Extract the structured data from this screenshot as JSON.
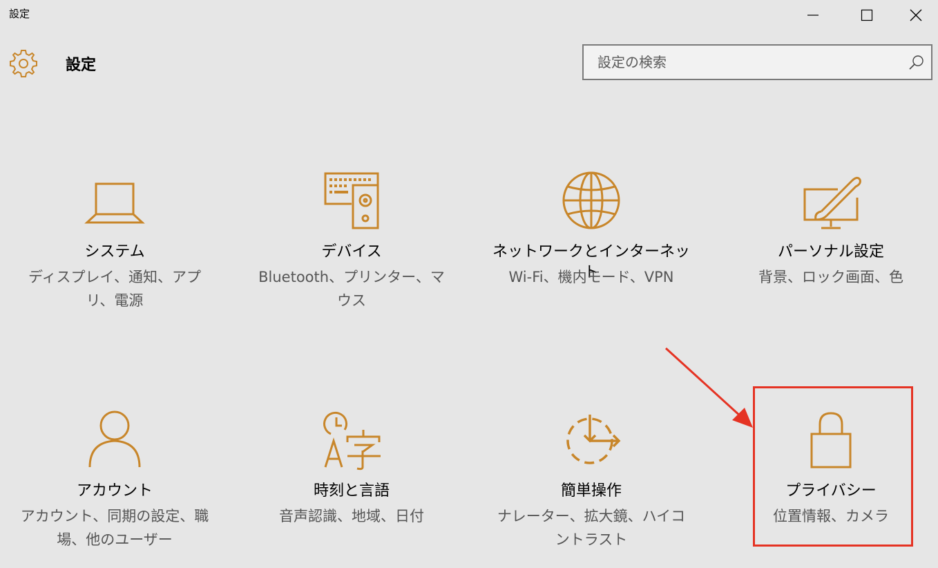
{
  "window": {
    "title": "設定"
  },
  "header": {
    "title": "設定",
    "icon": "gear-icon"
  },
  "search": {
    "placeholder": "設定の検索",
    "value": ""
  },
  "colors": {
    "accent": "#c8862a",
    "highlight": "#e53323",
    "background": "#e6e6e6"
  },
  "tiles": [
    {
      "icon": "laptop-icon",
      "label": "システム",
      "desc": "ディスプレイ、通知、アプリ、電源"
    },
    {
      "icon": "keyboard-speaker-icon",
      "label": "デバイス",
      "desc": "Bluetooth、プリンター、マウス"
    },
    {
      "icon": "globe-icon",
      "label": "ネットワークとインターネット",
      "desc": "Wi-Fi、機内モード、VPN"
    },
    {
      "icon": "monitor-brush-icon",
      "label": "パーソナル設定",
      "desc": "背景、ロック画面、色"
    },
    {
      "icon": "person-icon",
      "label": "アカウント",
      "desc": "アカウント、同期の設定、職場、他のユーザー"
    },
    {
      "icon": "clock-language-icon",
      "label": "時刻と言語",
      "desc": "音声認識、地域、日付"
    },
    {
      "icon": "ease-of-access-icon",
      "label": "簡単操作",
      "desc": "ナレーター、拡大鏡、ハイコントラスト"
    },
    {
      "icon": "lock-icon",
      "label": "プライバシー",
      "desc": "位置情報、カメラ"
    }
  ]
}
